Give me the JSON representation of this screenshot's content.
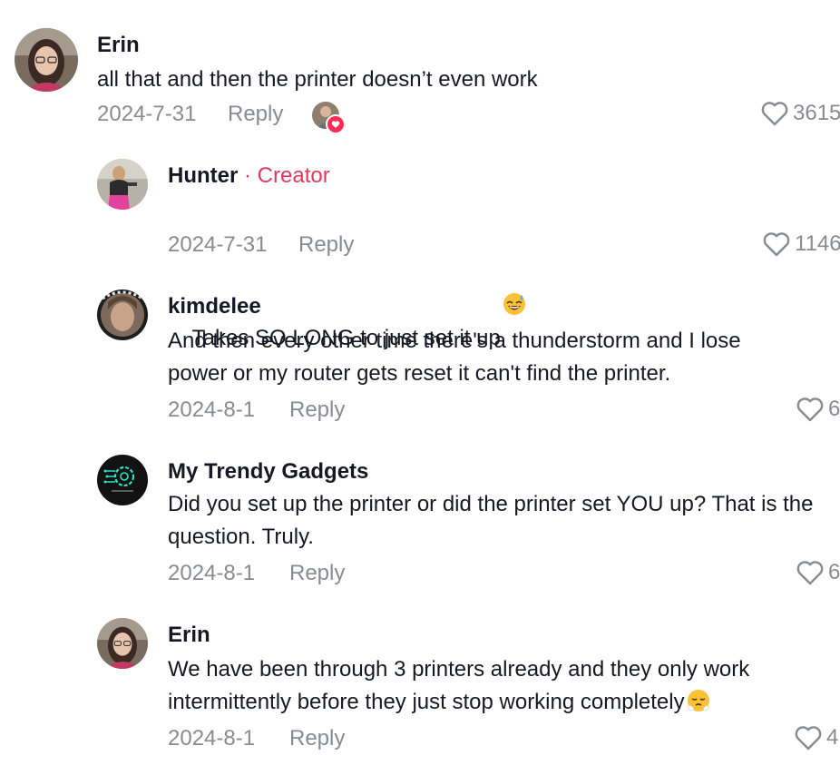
{
  "comments": [
    {
      "username": "Erin",
      "text": "all that and then the printer doesn’t even work",
      "date": "2024-7-31",
      "reply_label": "Reply",
      "likes": "3615",
      "avatar_icon": "user-avatar-erin"
    },
    {
      "username": "Hunter",
      "creator_tag": "· Creator",
      "text": "Takes SO LONG to just set it up",
      "emoji": "sweat-smile-emoji",
      "date": "2024-7-31",
      "reply_label": "Reply",
      "likes": "1146",
      "avatar_icon": "user-avatar-hunter"
    },
    {
      "username": "kimdelee",
      "text": "And then every other time there's a thunderstorm and I lose power or my router gets reset it can't find the printer.",
      "date": "2024-8-1",
      "reply_label": "Reply",
      "likes": "6",
      "avatar_icon": "user-avatar-kimdelee"
    },
    {
      "username": "My Trendy Gadgets",
      "text": "Did you set up the printer or did the printer set YOU up? That is the question. Truly.",
      "date": "2024-8-1",
      "reply_label": "Reply",
      "likes": "6",
      "avatar_icon": "gear-logo-avatar"
    },
    {
      "username": "Erin",
      "text": "We have been through 3 printers already and they only work intermittently before they just stop working completely",
      "emoji": "steam-face-emoji",
      "date": "2024-8-1",
      "reply_label": "Reply",
      "likes": "4",
      "avatar_icon": "user-avatar-erin"
    }
  ],
  "colors": {
    "text": "#161823",
    "muted": "#8a8b91",
    "creator": "#e03a5c",
    "heart_badge": "#fe2c55"
  }
}
